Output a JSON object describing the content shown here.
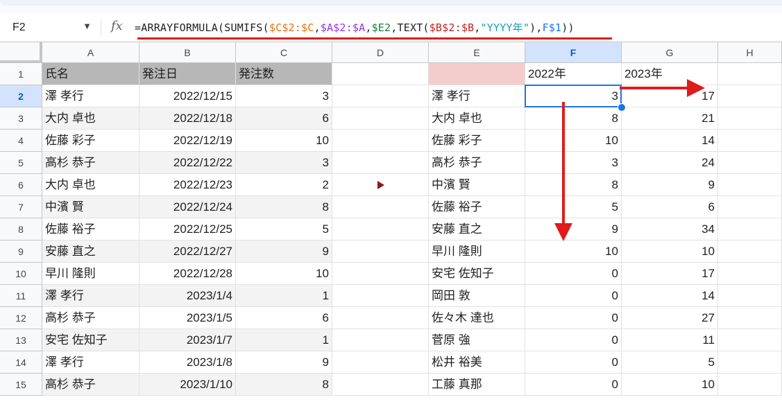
{
  "name_box": {
    "value": "F2"
  },
  "formula_bar": {
    "segments": [
      {
        "text": "=ARRAYFORMULA(SUMIFS(",
        "color": "default"
      },
      {
        "text": "$C$2:$C",
        "color": "orange"
      },
      {
        "text": ",",
        "color": "default"
      },
      {
        "text": "$A$2:$A",
        "color": "purple"
      },
      {
        "text": ",",
        "color": "default"
      },
      {
        "text": "$E2",
        "color": "green"
      },
      {
        "text": ",TEXT(",
        "color": "default"
      },
      {
        "text": "$B$2:$B",
        "color": "red"
      },
      {
        "text": ",",
        "color": "default"
      },
      {
        "text": "\"YYYY年\"",
        "color": "teal"
      },
      {
        "text": "),",
        "color": "default"
      },
      {
        "text": "F$1",
        "color": "blue"
      },
      {
        "text": "))",
        "color": "default"
      }
    ]
  },
  "colors": {
    "header_fill": "#b7b7b7",
    "criteria_fill": "#f4cccc",
    "selection": "#1a73e8",
    "arrow": "#e01b1b",
    "orange": "#e8710a",
    "purple": "#9334e6",
    "green": "#188038",
    "red": "#c5221f",
    "teal": "#129eaf",
    "blue": "#1a73e8"
  },
  "columns": [
    "A",
    "B",
    "C",
    "D",
    "E",
    "F",
    "G",
    "H"
  ],
  "rows": [
    "1",
    "2",
    "3",
    "4",
    "5",
    "6",
    "7",
    "8",
    "9",
    "10",
    "11",
    "12",
    "13",
    "14",
    "15"
  ],
  "selected": {
    "column": "F",
    "row": "2"
  },
  "left_table": {
    "headers": [
      "氏名",
      "発注日",
      "発注数"
    ],
    "rows": [
      [
        "澤 孝行",
        "2022/12/15",
        "3"
      ],
      [
        "大内 卓也",
        "2022/12/18",
        "6"
      ],
      [
        "佐藤 彩子",
        "2022/12/19",
        "10"
      ],
      [
        "高杉 恭子",
        "2022/12/22",
        "3"
      ],
      [
        "大内 卓也",
        "2022/12/23",
        "2"
      ],
      [
        "中濱 賢",
        "2022/12/24",
        "8"
      ],
      [
        "佐藤 裕子",
        "2022/12/25",
        "5"
      ],
      [
        "安藤 直之",
        "2022/12/27",
        "9"
      ],
      [
        "早川 隆則",
        "2022/12/28",
        "10"
      ],
      [
        "澤 孝行",
        "2023/1/4",
        "1"
      ],
      [
        "高杉 恭子",
        "2023/1/5",
        "6"
      ],
      [
        "安宅 佐知子",
        "2023/1/7",
        "1"
      ],
      [
        "澤 孝行",
        "2023/1/8",
        "9"
      ],
      [
        "高杉 恭子",
        "2023/1/10",
        "8"
      ]
    ]
  },
  "right_table": {
    "year_headers": [
      "2022年",
      "2023年"
    ],
    "rows": [
      [
        "澤 孝行",
        "3",
        "17"
      ],
      [
        "大内 卓也",
        "8",
        "21"
      ],
      [
        "佐藤 彩子",
        "10",
        "14"
      ],
      [
        "高杉 恭子",
        "3",
        "24"
      ],
      [
        "中濱 賢",
        "8",
        "9"
      ],
      [
        "佐藤 裕子",
        "5",
        "6"
      ],
      [
        "安藤 直之",
        "9",
        "34"
      ],
      [
        "早川 隆則",
        "10",
        "10"
      ],
      [
        "安宅 佐知子",
        "0",
        "17"
      ],
      [
        "岡田 敦",
        "0",
        "14"
      ],
      [
        "佐々木 達也",
        "0",
        "27"
      ],
      [
        "菅原 強",
        "0",
        "11"
      ],
      [
        "松井 裕美",
        "0",
        "5"
      ],
      [
        "工藤 真那",
        "0",
        "10"
      ]
    ]
  },
  "icons": {
    "name_box_dropdown": "chevron-down-icon",
    "formula": "fx-icon",
    "marker": "play-triangle-icon"
  }
}
